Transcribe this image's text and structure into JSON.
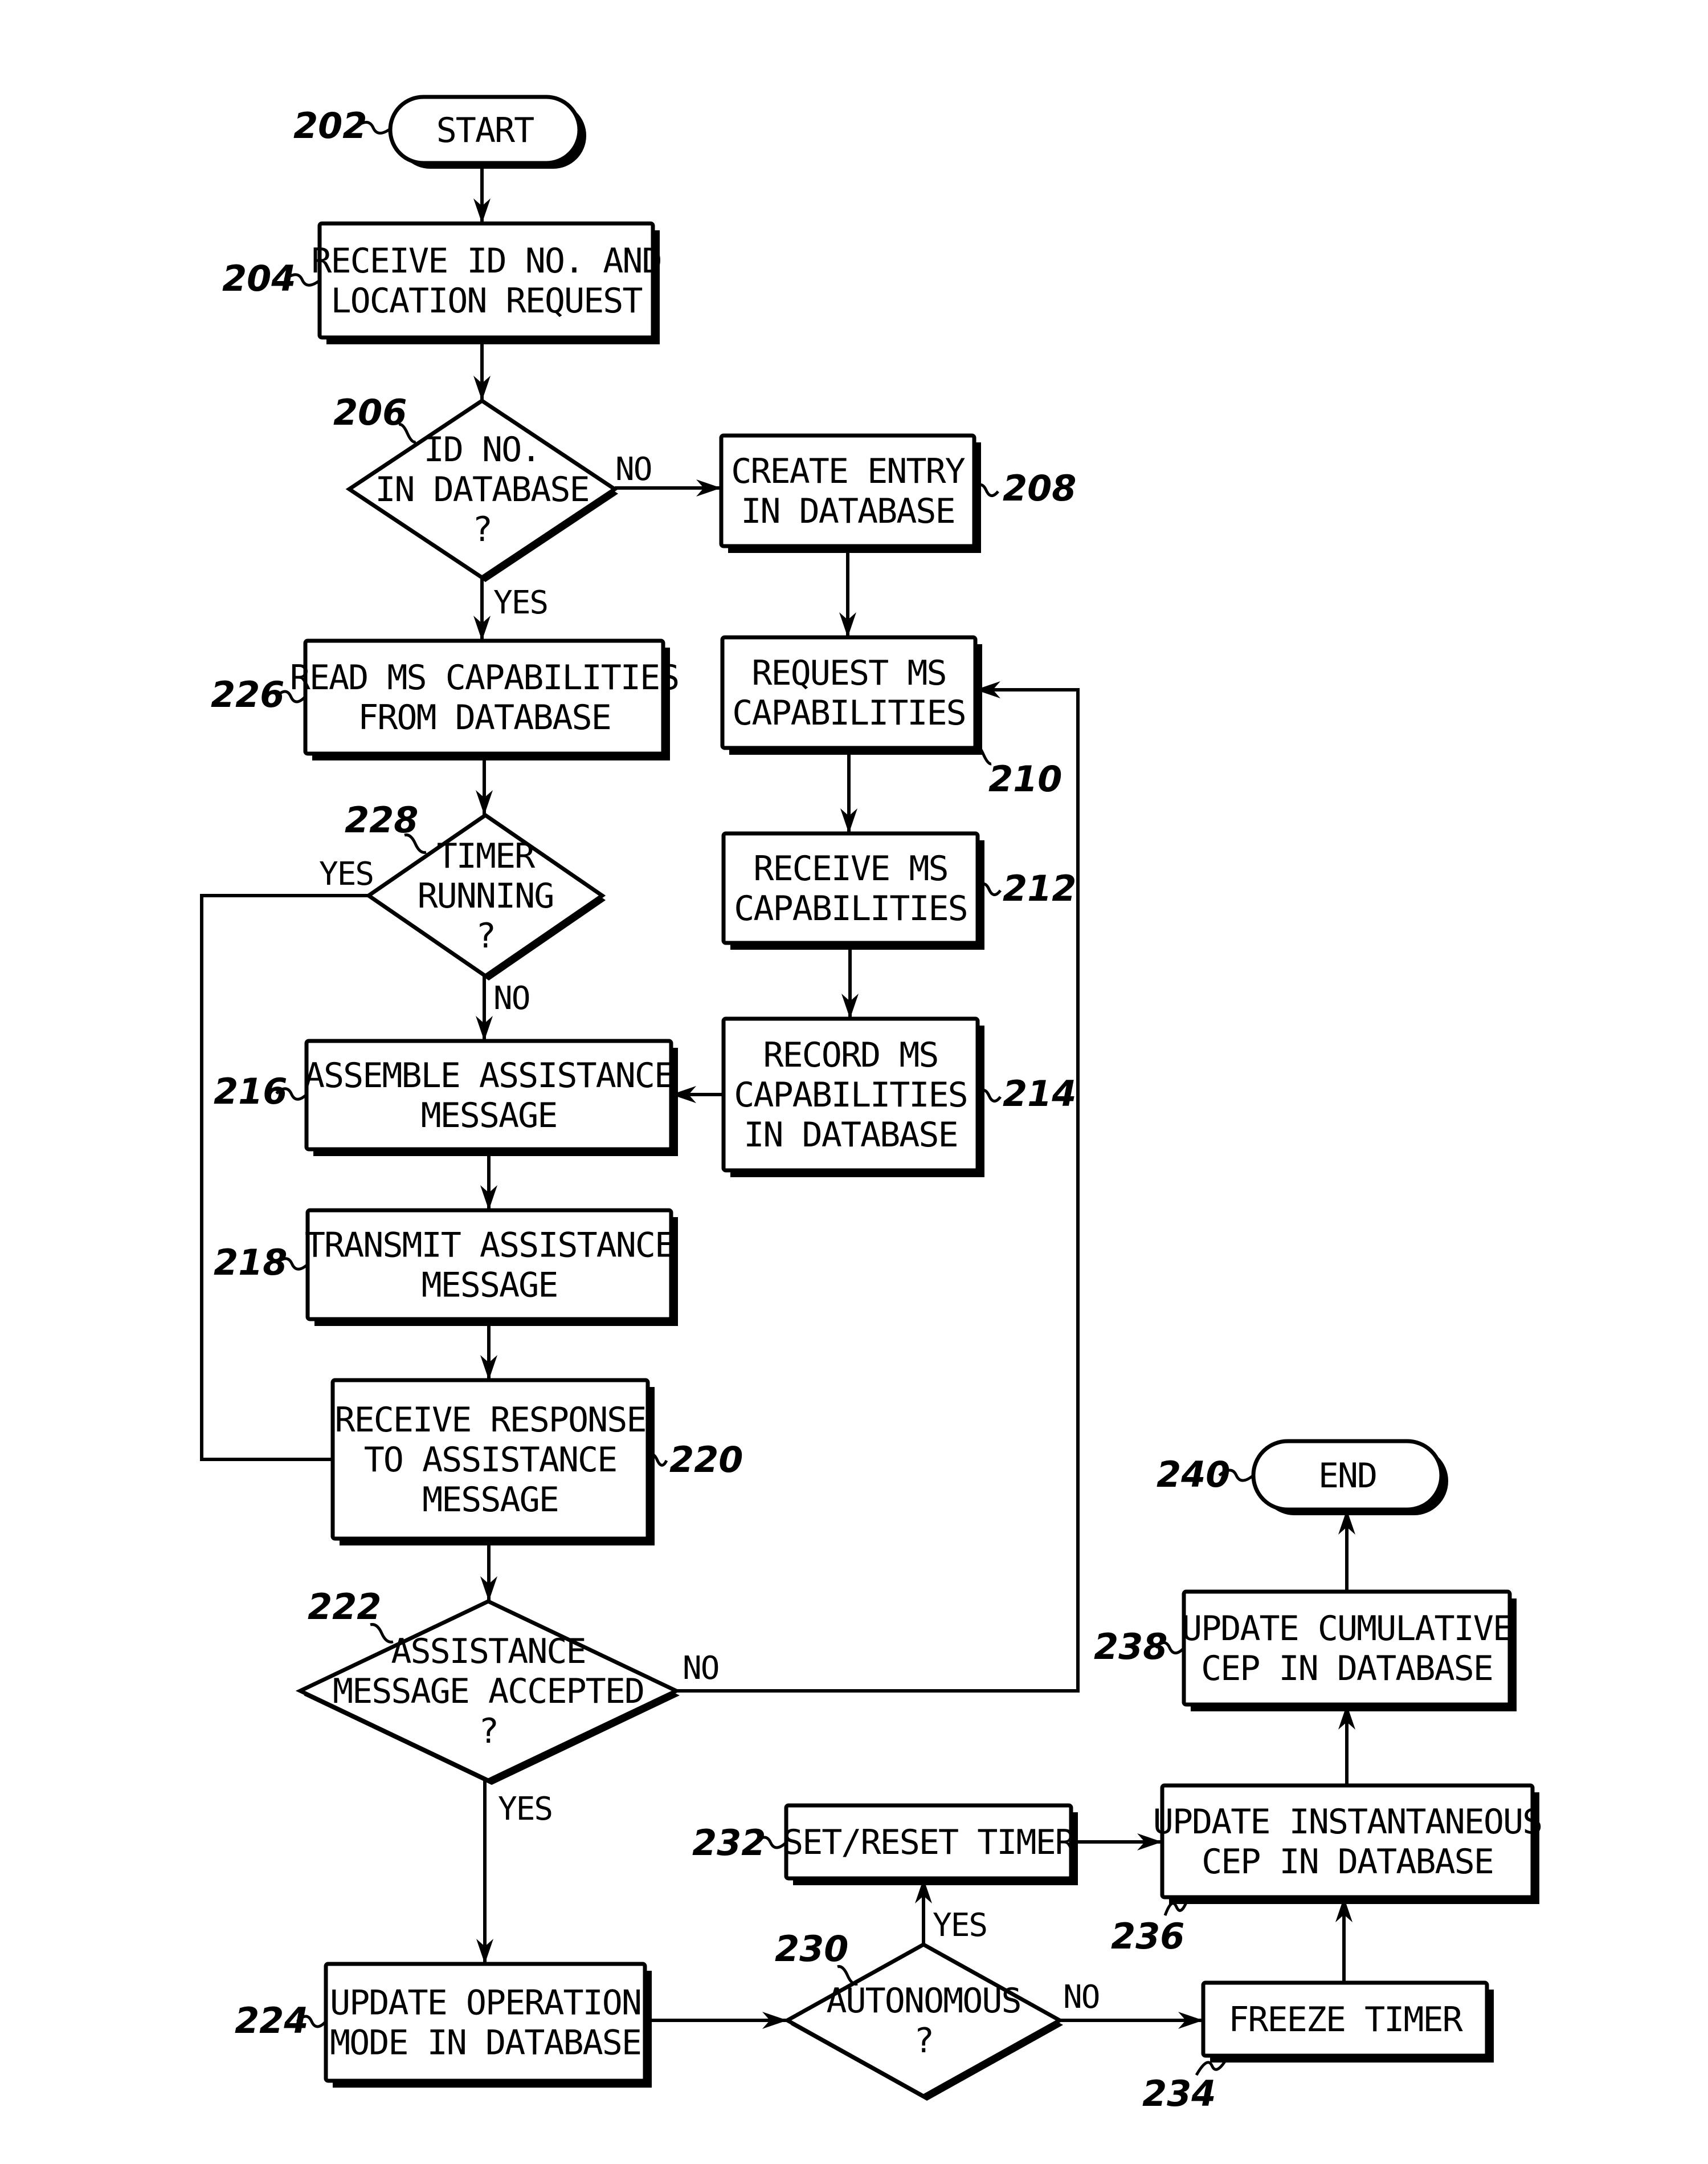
{
  "diagram": {
    "type": "flowchart",
    "nodes": [
      {
        "id": "202",
        "kind": "terminal",
        "lines": [
          "START"
        ]
      },
      {
        "id": "204",
        "kind": "process",
        "lines": [
          "RECEIVE ID NO. AND",
          "LOCATION REQUEST"
        ]
      },
      {
        "id": "206",
        "kind": "decision",
        "lines": [
          "ID NO.",
          "IN DATABASE",
          "?"
        ]
      },
      {
        "id": "208",
        "kind": "process",
        "lines": [
          "CREATE ENTRY",
          "IN DATABASE"
        ]
      },
      {
        "id": "210",
        "kind": "process",
        "lines": [
          "REQUEST MS",
          "CAPABILITIES"
        ]
      },
      {
        "id": "212",
        "kind": "process",
        "lines": [
          "RECEIVE MS",
          "CAPABILITIES"
        ]
      },
      {
        "id": "214",
        "kind": "process",
        "lines": [
          "RECORD MS",
          "CAPABILITIES",
          "IN DATABASE"
        ]
      },
      {
        "id": "226",
        "kind": "process",
        "lines": [
          "READ MS CAPABILITIES",
          "FROM DATABASE"
        ]
      },
      {
        "id": "228",
        "kind": "decision",
        "lines": [
          "TIMER",
          "RUNNING",
          "?"
        ]
      },
      {
        "id": "216",
        "kind": "process",
        "lines": [
          "ASSEMBLE ASSISTANCE",
          "MESSAGE"
        ]
      },
      {
        "id": "218",
        "kind": "process",
        "lines": [
          "TRANSMIT ASSISTANCE",
          "MESSAGE"
        ]
      },
      {
        "id": "220",
        "kind": "process",
        "lines": [
          "RECEIVE RESPONSE",
          "TO ASSISTANCE",
          "MESSAGE"
        ]
      },
      {
        "id": "222",
        "kind": "decision",
        "lines": [
          "ASSISTANCE",
          "MESSAGE ACCEPTED",
          "?"
        ]
      },
      {
        "id": "224",
        "kind": "process",
        "lines": [
          "UPDATE OPERATION",
          "MODE IN DATABASE"
        ]
      },
      {
        "id": "230",
        "kind": "decision",
        "lines": [
          "AUTONOMOUS",
          "?"
        ]
      },
      {
        "id": "232",
        "kind": "process",
        "lines": [
          "SET/RESET TIMER"
        ]
      },
      {
        "id": "234",
        "kind": "process",
        "lines": [
          "FREEZE TIMER"
        ]
      },
      {
        "id": "236",
        "kind": "process",
        "lines": [
          "UPDATE INSTANTANEOUS",
          "CEP IN DATABASE"
        ]
      },
      {
        "id": "238",
        "kind": "process",
        "lines": [
          "UPDATE CUMULATIVE",
          "CEP IN DATABASE"
        ]
      },
      {
        "id": "240",
        "kind": "terminal",
        "lines": [
          "END"
        ]
      }
    ],
    "edges": [
      {
        "from": "202",
        "to": "204",
        "label": ""
      },
      {
        "from": "204",
        "to": "206",
        "label": ""
      },
      {
        "from": "206",
        "to": "208",
        "label": "NO"
      },
      {
        "from": "206",
        "to": "226",
        "label": "YES"
      },
      {
        "from": "208",
        "to": "210",
        "label": ""
      },
      {
        "from": "210",
        "to": "212",
        "label": ""
      },
      {
        "from": "212",
        "to": "214",
        "label": ""
      },
      {
        "from": "214",
        "to": "216",
        "label": ""
      },
      {
        "from": "226",
        "to": "228",
        "label": ""
      },
      {
        "from": "228",
        "to": "216",
        "label": "NO"
      },
      {
        "from": "228",
        "to": "220",
        "label": "YES"
      },
      {
        "from": "216",
        "to": "218",
        "label": ""
      },
      {
        "from": "218",
        "to": "220",
        "label": ""
      },
      {
        "from": "220",
        "to": "222",
        "label": ""
      },
      {
        "from": "222",
        "to": "210",
        "label": "NO"
      },
      {
        "from": "222",
        "to": "224",
        "label": "YES"
      },
      {
        "from": "224",
        "to": "230",
        "label": ""
      },
      {
        "from": "230",
        "to": "232",
        "label": "YES"
      },
      {
        "from": "230",
        "to": "234",
        "label": "NO"
      },
      {
        "from": "232",
        "to": "236",
        "label": ""
      },
      {
        "from": "234",
        "to": "236",
        "label": ""
      },
      {
        "from": "236",
        "to": "238",
        "label": ""
      },
      {
        "from": "238",
        "to": "240",
        "label": ""
      }
    ]
  },
  "labels": {
    "no_206": "NO",
    "yes_206": "YES",
    "yes_228": "YES",
    "no_228": "NO",
    "no_222": "NO",
    "yes_222": "YES",
    "yes_230": "YES",
    "no_230": "NO"
  }
}
